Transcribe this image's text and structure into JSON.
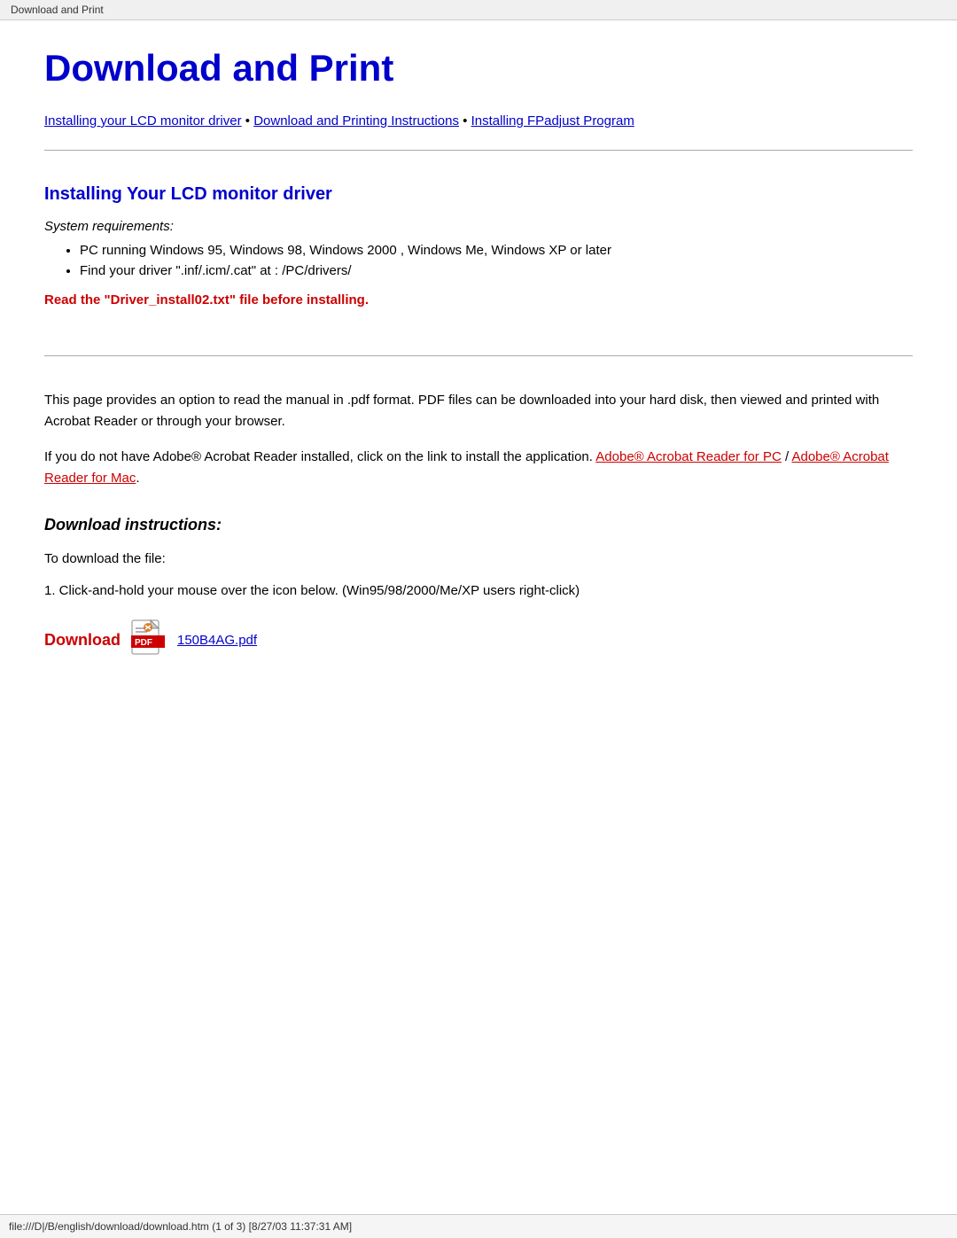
{
  "browser_tab": {
    "label": "Download and Print"
  },
  "page": {
    "title": "Download and Print",
    "nav": {
      "link1": "Installing your LCD monitor driver",
      "separator1": " • ",
      "link2": "Download and Printing Instructions",
      "separator2": " • ",
      "link3": "Installing FPadjust Program"
    },
    "section1": {
      "title": "Installing Your LCD monitor driver",
      "system_req_label": "System requirements:",
      "bullet1": "",
      "bullet2": "PC running Windows 95, Windows 98, Windows 2000 , Windows Me, Windows XP or later",
      "bullet3": "Find your driver \".inf/.icm/.cat\" at : /PC/drivers/",
      "warning": "Read the \"Driver_install02.txt\" file before installing."
    },
    "section2": {
      "pdf_description1": "This page provides an option to read the manual in .pdf format. PDF files can be downloaded into your hard disk, then viewed and printed with Acrobat Reader or through your browser.",
      "acrobat_text_before": "If you do not have Adobe® Acrobat Reader installed, click on the link to install the application. ",
      "acrobat_link1": "Adobe® Acrobat Reader for PC",
      "acrobat_separator": " / ",
      "acrobat_link2": "Adobe® Acrobat Reader for Mac",
      "acrobat_text_after": ".",
      "download_instructions_title": "Download instructions:",
      "to_download": "To download the file:",
      "step1": "1. Click-and-hold your mouse over the icon below. (Win95/98/2000/Me/XP users right-click)",
      "download_label": "Download",
      "pdf_filename": "150B4AG.pdf"
    },
    "status_bar": "file:///D|/B/english/download/download.htm (1 of 3) [8/27/03 11:37:31 AM]"
  }
}
